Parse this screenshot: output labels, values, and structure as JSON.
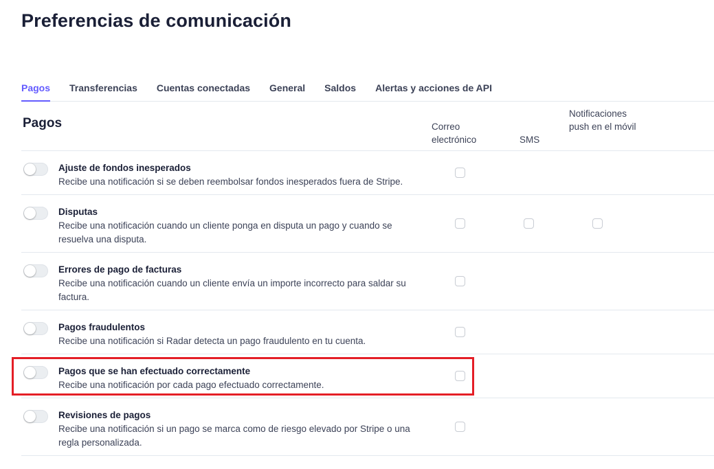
{
  "page": {
    "title": "Preferencias de comunicación"
  },
  "tabs": [
    {
      "label": "Pagos",
      "active": true
    },
    {
      "label": "Transferencias",
      "active": false
    },
    {
      "label": "Cuentas conectadas",
      "active": false
    },
    {
      "label": "General",
      "active": false
    },
    {
      "label": "Saldos",
      "active": false
    },
    {
      "label": "Alertas y acciones de API",
      "active": false
    }
  ],
  "section": {
    "title": "Pagos",
    "columns": {
      "email": "Correo electrónico",
      "sms": "SMS",
      "push": "Notificaciones push en el móvil"
    }
  },
  "rows": [
    {
      "title": "Ajuste de fondos inesperados",
      "description": "Recibe una notificación si se deben reembolsar fondos inesperados fuera de Stripe.",
      "enabled": false,
      "channels": [
        "email"
      ]
    },
    {
      "title": "Disputas",
      "description": "Recibe una notificación cuando un cliente ponga en disputa un pago y cuando se resuelva una disputa.",
      "enabled": false,
      "channels": [
        "email",
        "sms",
        "push"
      ]
    },
    {
      "title": "Errores de pago de facturas",
      "description": "Recibe una notificación cuando un cliente envía un importe incorrecto para saldar su factura.",
      "enabled": false,
      "channels": [
        "email"
      ]
    },
    {
      "title": "Pagos fraudulentos",
      "description": "Recibe una notificación si Radar detecta un pago fraudulento en tu cuenta.",
      "enabled": false,
      "channels": [
        "email"
      ]
    },
    {
      "title": "Pagos que se han efectuado correctamente",
      "description": "Recibe una notificación por cada pago efectuado correctamente.",
      "enabled": false,
      "channels": [
        "email"
      ],
      "highlighted": true
    },
    {
      "title": "Revisiones de pagos",
      "description": "Recibe una notificación si un pago se marca como de riesgo elevado por Stripe o una regla personalizada.",
      "enabled": false,
      "channels": [
        "email"
      ]
    }
  ],
  "colors": {
    "accent": "#635bff",
    "highlight_border": "#e41e26",
    "divider": "#e3e8ee"
  }
}
